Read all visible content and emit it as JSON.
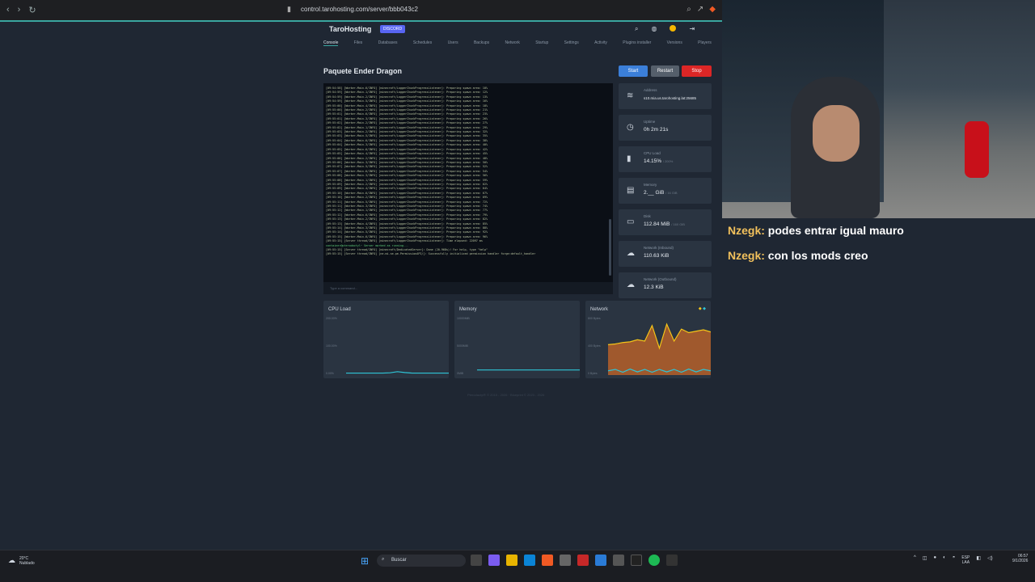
{
  "browser": {
    "url": "control.tarohosting.com/server/bbb043c2"
  },
  "panel": {
    "brand": "TaroHosting",
    "discord_label": "DISCORD",
    "tabs": [
      "Console",
      "Files",
      "Databases",
      "Schedules",
      "Users",
      "Backups",
      "Network",
      "Startup",
      "Settings",
      "Activity",
      "Plugins installer",
      "Versions",
      "Players"
    ],
    "server_title": "Paquete Ender Dragon",
    "buttons": {
      "start": "Start",
      "restart": "Restart",
      "stop": "Stop"
    },
    "command_placeholder": "Type a command...",
    "stats": [
      {
        "label": "Address",
        "value": "s10.mia.us.tarohosting.lat:25685",
        "sub": "",
        "icon": "wifi-icon"
      },
      {
        "label": "Uptime",
        "value": "0h 2m 21s",
        "sub": "",
        "icon": "clock-icon"
      },
      {
        "label": "CPU Load",
        "value": "14.15%",
        "sub": "/ 200%",
        "icon": "cpu-icon"
      },
      {
        "label": "Memory",
        "value": "2.__ GiB",
        "sub": "/ 16 GiB",
        "icon": "memory-icon"
      },
      {
        "label": "Disk",
        "value": "112.84 MiB",
        "sub": "/ 160 GiB",
        "icon": "disk-icon"
      },
      {
        "label": "Network (Inbound)",
        "value": "110.63 KiB",
        "sub": "",
        "icon": "cloud-download-icon"
      },
      {
        "label": "Network (Outbound)",
        "value": "12.3 KiB",
        "sub": "",
        "icon": "cloud-upload-icon"
      }
    ],
    "graphs": {
      "cpu": {
        "title": "CPU Load",
        "ticks": [
          "200.00%",
          "100.00%",
          "0.00%"
        ]
      },
      "memory": {
        "title": "Memory",
        "ticks": [
          "10000MiB",
          "5000MiB",
          "0MiB"
        ]
      },
      "network": {
        "title": "Network",
        "ticks": [
          "800 Bytes",
          "400 Bytes",
          "0 Bytes"
        ]
      }
    },
    "footer": "Pterodactyl® © 2015 - 2026 · Blueprint © 2023 - 2026"
  },
  "console_lines": [
    "[09:54:58] [Worker-Main-6/INFO] [minecraft/LoggerChunkProgressListener]: Preparing spawn area: 10%",
    "[09:54:59] [Worker-Main-1/INFO] [minecraft/LoggerChunkProgressListener]: Preparing spawn area: 12%",
    "[09:54:59] [Worker-Main-2/INFO] [minecraft/LoggerChunkProgressListener]: Preparing spawn area: 13%",
    "[09:54:59] [Worker-Main-5/INFO] [minecraft/LoggerChunkProgressListener]: Preparing spawn area: 16%",
    "[09:55:00] [Worker-Main-4/INFO] [minecraft/LoggerChunkProgressListener]: Preparing spawn area: 18%",
    "[09:55:00] [Worker-Main-2/INFO] [minecraft/LoggerChunkProgressListener]: Preparing spawn area: 21%",
    "[09:55:01] [Worker-Main-6/INFO] [minecraft/LoggerChunkProgressListener]: Preparing spawn area: 23%",
    "[09:55:01] [Worker-Main-3/INFO] [minecraft/LoggerChunkProgressListener]: Preparing spawn area: 26%",
    "[09:55:02] [Worker-Main-2/INFO] [minecraft/LoggerChunkProgressListener]: Preparing spawn area: 27%",
    "[09:55:02] [Worker-Main-1/INFO] [minecraft/LoggerChunkProgressListener]: Preparing spawn area: 29%",
    "[09:55:03] [Worker-Main-2/INFO] [minecraft/LoggerChunkProgressListener]: Preparing spawn area: 32%",
    "[09:55:03] [Worker-Main-5/INFO] [minecraft/LoggerChunkProgressListener]: Preparing spawn area: 35%",
    "[09:55:04] [Worker-Main-6/INFO] [minecraft/LoggerChunkProgressListener]: Preparing spawn area: 38%",
    "[09:55:04] [Worker-Main-3/INFO] [minecraft/LoggerChunkProgressListener]: Preparing spawn area: 40%",
    "[09:55:05] [Worker-Main-6/INFO] [minecraft/LoggerChunkProgressListener]: Preparing spawn area: 42%",
    "[09:55:05] [Worker-Main-4/INFO] [minecraft/LoggerChunkProgressListener]: Preparing spawn area: 45%",
    "[09:55:06] [Worker-Main-2/INFO] [minecraft/LoggerChunkProgressListener]: Preparing spawn area: 48%",
    "[09:55:06] [Worker-Main-3/INFO] [minecraft/LoggerChunkProgressListener]: Preparing spawn area: 50%",
    "[09:55:07] [Worker-Main-5/INFO] [minecraft/LoggerChunkProgressListener]: Preparing spawn area: 52%",
    "[09:55:07] [Worker-Main-6/INFO] [minecraft/LoggerChunkProgressListener]: Preparing spawn area: 54%",
    "[09:55:08] [Worker-Main-3/INFO] [minecraft/LoggerChunkProgressListener]: Preparing spawn area: 56%",
    "[09:55:08] [Worker-Main-1/INFO] [minecraft/LoggerChunkProgressListener]: Preparing spawn area: 59%",
    "[09:55:09] [Worker-Main-2/INFO] [minecraft/LoggerChunkProgressListener]: Preparing spawn area: 62%",
    "[09:55:09] [Worker-Main-4/INFO] [minecraft/LoggerChunkProgressListener]: Preparing spawn area: 64%",
    "[09:55:10] [Worker-Main-6/INFO] [minecraft/LoggerChunkProgressListener]: Preparing spawn area: 67%",
    "[09:55:10] [Worker-Main-2/INFO] [minecraft/LoggerChunkProgressListener]: Preparing spawn area: 69%",
    "[09:55:11] [Worker-Main-5/INFO] [minecraft/LoggerChunkProgressListener]: Preparing spawn area: 72%",
    "[09:55:11] [Worker-Main-3/INFO] [minecraft/LoggerChunkProgressListener]: Preparing spawn area: 74%",
    "[09:55:12] [Worker-Main-1/INFO] [minecraft/LoggerChunkProgressListener]: Preparing spawn area: 77%",
    "[09:55:12] [Worker-Main-6/INFO] [minecraft/LoggerChunkProgressListener]: Preparing spawn area: 79%",
    "[09:55:13] [Worker-Main-2/INFO] [minecraft/LoggerChunkProgressListener]: Preparing spawn area: 82%",
    "[09:55:13] [Worker-Main-4/INFO] [minecraft/LoggerChunkProgressListener]: Preparing spawn area: 85%",
    "[09:55:14] [Worker-Main-3/INFO] [minecraft/LoggerChunkProgressListener]: Preparing spawn area: 88%",
    "[09:55:14] [Worker-Main-5/INFO] [minecraft/LoggerChunkProgressListener]: Preparing spawn area: 92%",
    "[09:55:15] [Worker-Main-6/INFO] [minecraft/LoggerChunkProgressListener]: Preparing spawn area: 96%",
    "[09:55:15] [Server thread/INFO] [minecraft/LoggerChunkProgressListener]: Time elapsed: 22097 ms",
    "container@pterodactyl~ Server marked as running...",
    "[09:55:15] [Server thread/INFO] [minecraft/DedicatedServer]: Done (20.968s)! For help, type \"help\"",
    "[09:55:15] [Server thread/INFO] [ne.mi.se.pe.PermissionAPI/]: Successfully initialized permission handler forge:default_handler"
  ],
  "chat": [
    {
      "user": "Nzegk:",
      "text": "podes entrar igual mauro"
    },
    {
      "user": "Nzegk:",
      "text": "con los mods creo"
    }
  ],
  "taskbar": {
    "weather_temp": "20°C",
    "weather_text": "Nublado",
    "search": "Buscar",
    "lang": "ESP",
    "region": "LAA",
    "time": "06:57",
    "date": "9/1/2026"
  },
  "chart_data": [
    {
      "type": "line",
      "title": "CPU Load",
      "ylim": [
        0,
        200
      ],
      "series": [
        {
          "values": [
            7,
            7,
            7,
            7,
            7,
            7,
            8,
            12,
            9,
            7,
            7,
            7,
            7,
            7,
            7
          ]
        }
      ]
    },
    {
      "type": "line",
      "title": "Memory",
      "ylim": [
        0,
        10000
      ],
      "series": [
        {
          "values": [
            900,
            900,
            900,
            900,
            900,
            900,
            900,
            900,
            900,
            900,
            900,
            900,
            900
          ]
        }
      ]
    },
    {
      "type": "area",
      "title": "Network",
      "ylim": [
        0,
        800
      ],
      "series": [
        {
          "values": [
            430,
            440,
            460,
            470,
            500,
            480,
            700,
            380,
            720,
            480,
            650,
            600,
            620,
            640,
            610
          ]
        },
        {
          "values": [
            60,
            80,
            40,
            85,
            45,
            80,
            40,
            80,
            45,
            80,
            40,
            85,
            45,
            80,
            60
          ]
        }
      ]
    }
  ]
}
